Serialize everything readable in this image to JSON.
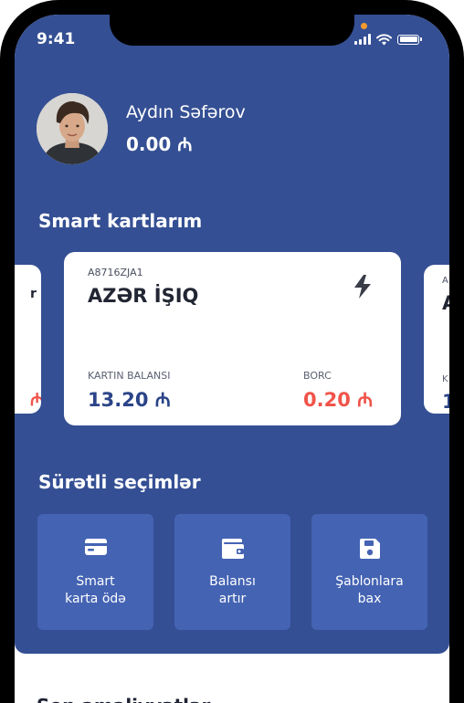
{
  "status_bar": {
    "time": "9:41"
  },
  "profile": {
    "name": "Aydın Səfərov",
    "balance": "0.00 ₼"
  },
  "cards_section": {
    "title": "Smart kartlarım"
  },
  "cards": {
    "main": {
      "code": "A8716ZJA1",
      "name": "AZƏR İŞIQ",
      "balance_label": "KARTIN BALANSI",
      "balance_value": "13.20 ₼",
      "debt_label": "BORC",
      "debt_value": "0.20 ₼",
      "icon": "lightning-icon"
    },
    "prev_partial": {
      "name_fragment": "r",
      "value_fragment": "₼"
    },
    "next_partial": {
      "code_fragment": "A",
      "name_fragment": "A",
      "label_fragment": "K",
      "value_fragment": "1"
    }
  },
  "quick_section": {
    "title": "Sürətli seçimlər"
  },
  "quick_actions": [
    {
      "line1": "Smart",
      "line2": "karta ödə",
      "icon": "credit-card-icon"
    },
    {
      "line1": "Balansı",
      "line2": "artır",
      "icon": "wallet-icon"
    },
    {
      "line1": "Şablonlara",
      "line2": "bax",
      "icon": "save-icon"
    }
  ],
  "bottom_section": {
    "title": "Son əməliyyatlar"
  },
  "colors": {
    "hero": "#344f93",
    "tile": "#4463b3",
    "accent_red": "#f0534a",
    "accent_blue": "#2b4488"
  }
}
